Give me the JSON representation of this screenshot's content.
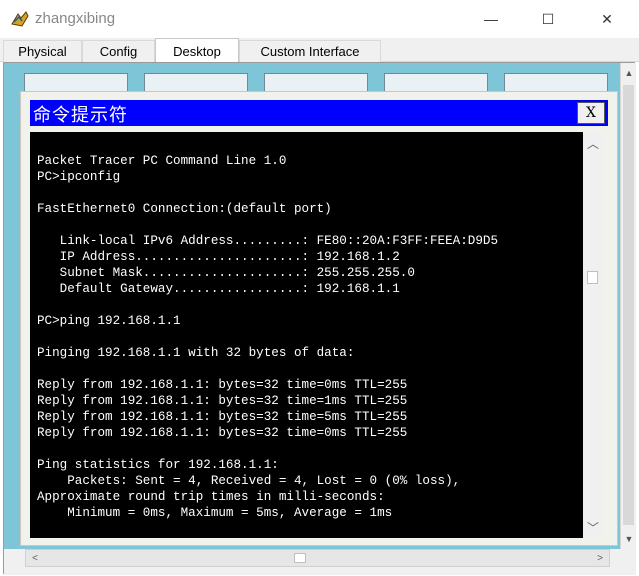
{
  "window": {
    "title": "zhangxibing",
    "minimize_icon": "minimize-icon",
    "maximize_icon": "maximize-icon",
    "close_icon": "close-icon",
    "minimize_glyph": "—",
    "maximize_glyph": "☐",
    "close_glyph": "✕"
  },
  "tabs": [
    {
      "label": "Physical",
      "active": false
    },
    {
      "label": "Config",
      "active": false
    },
    {
      "label": "Desktop",
      "active": true
    },
    {
      "label": "Custom Interface",
      "active": false
    }
  ],
  "command_prompt": {
    "title": "命令提示符",
    "close_label": "X",
    "lines": [
      "Packet Tracer PC Command Line 1.0",
      "PC>ipconfig",
      "",
      "FastEthernet0 Connection:(default port)",
      "",
      "   Link-local IPv6 Address.........: FE80::20A:F3FF:FEEA:D9D5",
      "   IP Address......................: 192.168.1.2",
      "   Subnet Mask.....................: 255.255.255.0",
      "   Default Gateway.................: 192.168.1.1",
      "",
      "PC>ping 192.168.1.1",
      "",
      "Pinging 192.168.1.1 with 32 bytes of data:",
      "",
      "Reply from 192.168.1.1: bytes=32 time=0ms TTL=255",
      "Reply from 192.168.1.1: bytes=32 time=1ms TTL=255",
      "Reply from 192.168.1.1: bytes=32 time=5ms TTL=255",
      "Reply from 192.168.1.1: bytes=32 time=0ms TTL=255",
      "",
      "Ping statistics for 192.168.1.1:",
      "    Packets: Sent = 4, Received = 4, Lost = 0 (0% loss),",
      "Approximate round trip times in milli-seconds:",
      "    Minimum = 0ms, Maximum = 5ms, Average = 1ms"
    ]
  },
  "scrollbars": {
    "up_glyph": "︿",
    "down_glyph": "﹀",
    "left_glyph": "<",
    "right_glyph": ">",
    "small_up": "▲",
    "small_down": "▼"
  },
  "colors": {
    "cmd_title_bg": "#0000ff",
    "desktop_bg": "#7ec6d7",
    "terminal_bg": "#000000",
    "terminal_fg": "#ffffff"
  }
}
